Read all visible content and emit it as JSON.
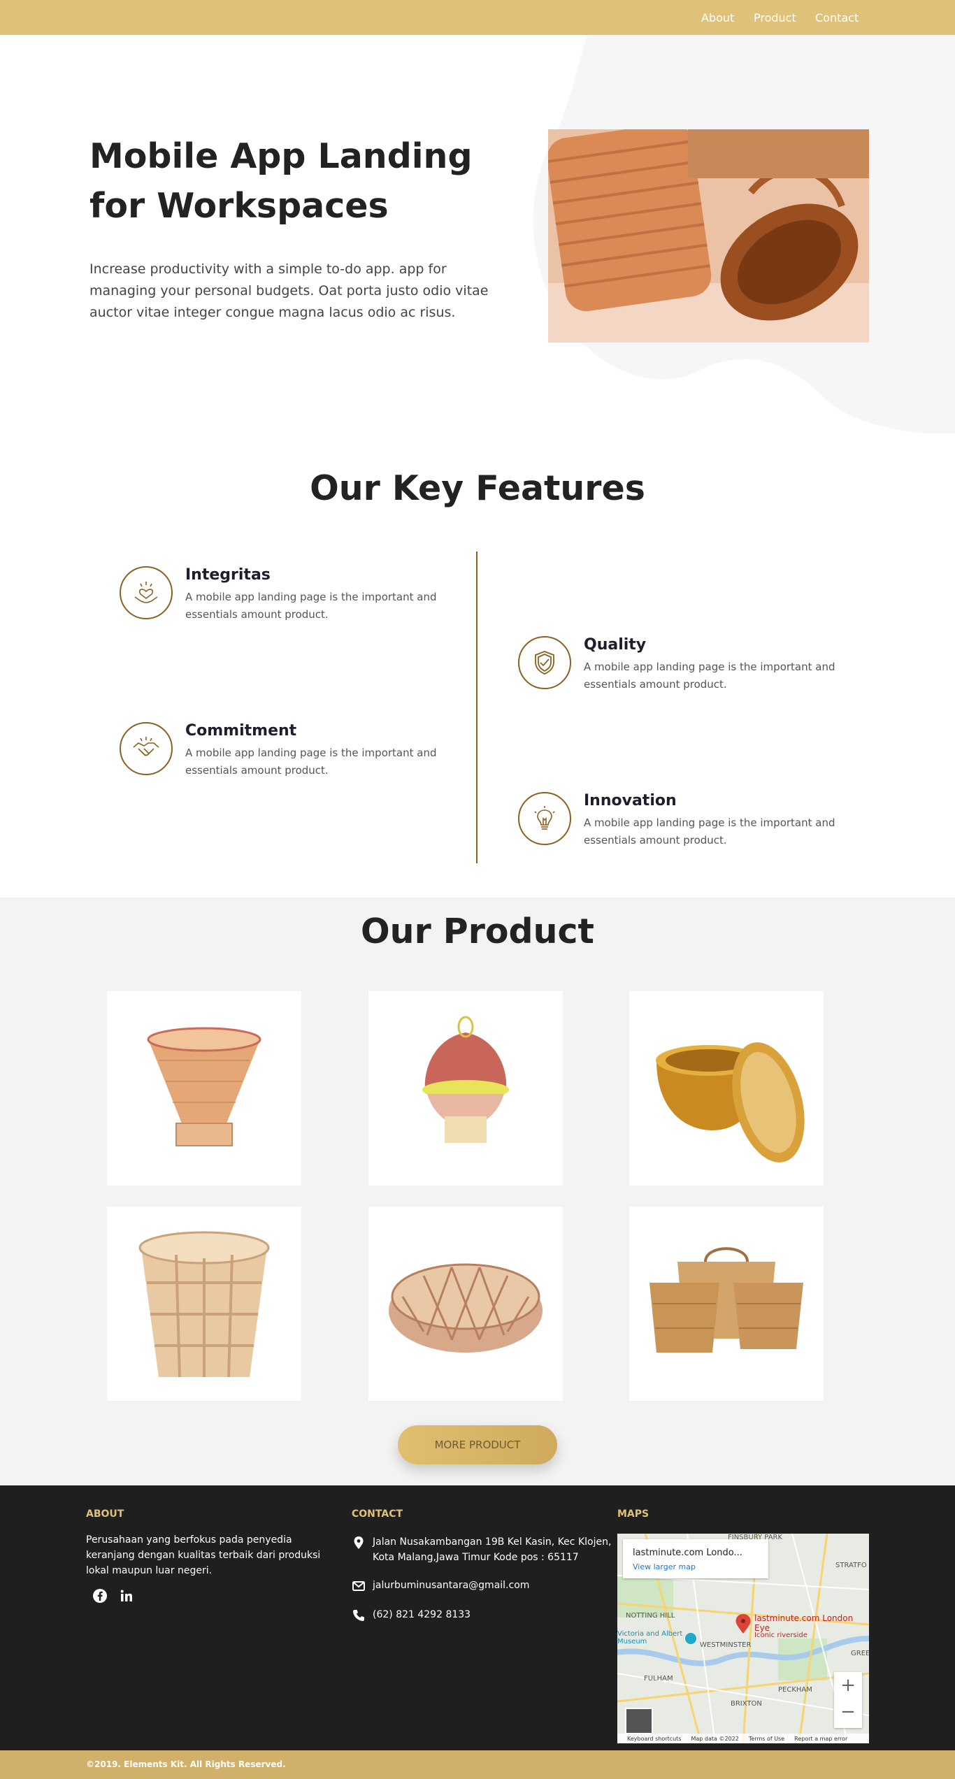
{
  "nav": {
    "items": [
      "About",
      "Product",
      "Contact"
    ]
  },
  "hero": {
    "title": "Mobile App Landing for Workspaces",
    "text": "Increase productivity with a simple to-do app. app for managing your personal budgets. Oat porta justo odio vitae auctor vitae integer congue magna lacus odio ac risus."
  },
  "features": {
    "title_light": "Our Key ",
    "title_bold": "Features",
    "items": [
      {
        "title": "Integritas",
        "text": "A mobile app landing page is the important and essentials amount product.",
        "icon": "heart-hands-icon"
      },
      {
        "title": "Quality",
        "text": "A mobile app landing page is the important and essentials amount product.",
        "icon": "shield-check-icon"
      },
      {
        "title": "Commitment",
        "text": "A mobile app landing page is the important and essentials amount product.",
        "icon": "handshake-icon"
      },
      {
        "title": "Innovation",
        "text": "A mobile app landing page is the important and essentials amount product.",
        "icon": "lightbulb-icon"
      }
    ]
  },
  "products": {
    "title_light": "Our ",
    "title_bold": "Product",
    "more_label": "MORE PRODUCT"
  },
  "footer": {
    "about_heading": "ABOUT",
    "about_text": "Perusahaan yang berfokus pada penyedia keranjang dengan kualitas terbaik dari produksi lokal maupun luar negeri.",
    "contact_heading": "CONTACT",
    "address": "Jalan Nusakambangan 19B Kel Kasin, Kec Klojen, Kota Malang,Jawa Timur Kode pos : 65117",
    "email": "jalurbuminusantara@gmail.com",
    "phone": "(62) 821 4292 8133",
    "maps_heading": "MAPS",
    "map": {
      "place_title": "lastminute.com Londo...",
      "larger_map": "View larger map",
      "pin_label": "lastminute.com London Eye",
      "pin_sub": "Iconic riverside",
      "labels": [
        "FINSBURY PARK",
        "NOTTING HILL",
        "Victoria and Albert Museum",
        "WESTMINSTER",
        "FULHAM",
        "BRIXTON",
        "PECKHAM",
        "STRATFO",
        "GREE"
      ],
      "attribution": [
        "Keyboard shortcuts",
        "Map data ©2022",
        "Terms of Use",
        "Report a map error"
      ]
    },
    "copyright": "©2019. Elements Kit. All Rights Reserved."
  },
  "colors": {
    "gold": "#E0C178",
    "brown": "#8B6121",
    "footer": "#1F1F1F"
  }
}
